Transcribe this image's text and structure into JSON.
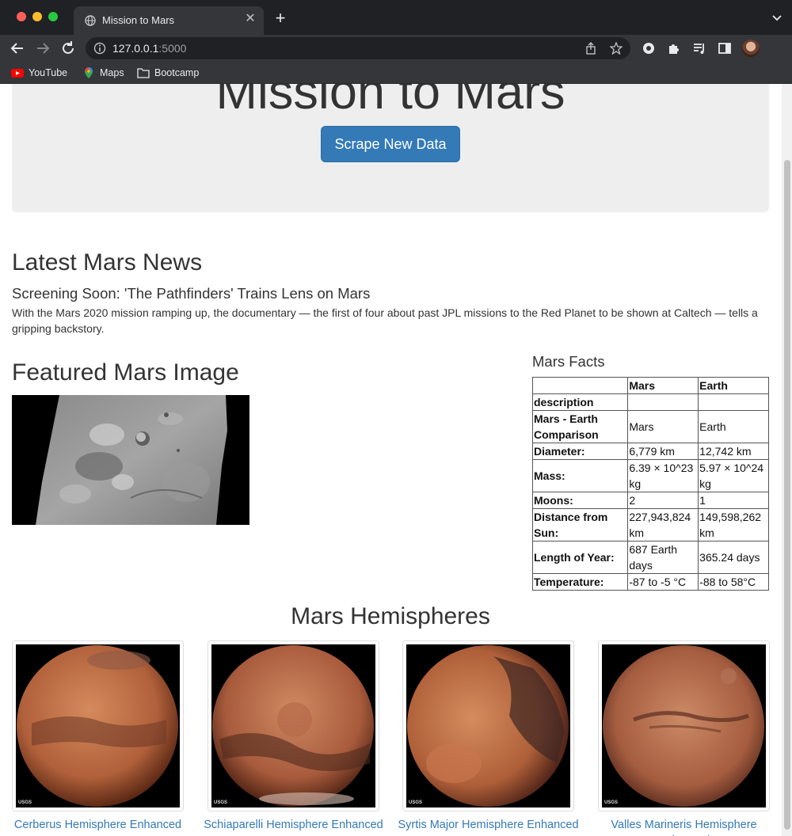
{
  "browser": {
    "tab_title": "Mission to Mars",
    "url_host": "127.0.0.1",
    "url_port": ":5000",
    "bookmarks": [
      "YouTube",
      "Maps",
      "Bootcamp"
    ]
  },
  "header": {
    "title": "Mission to Mars",
    "scrape_button": "Scrape New Data"
  },
  "news": {
    "heading": "Latest Mars News",
    "title": "Screening Soon: 'The Pathfinders' Trains Lens on Mars",
    "paragraph": "With the Mars 2020 mission ramping up, the documentary — the first of four about past JPL missions to the Red Planet to be shown at Caltech — tells a gripping backstory."
  },
  "featured": {
    "heading": "Featured Mars Image"
  },
  "facts": {
    "heading": "Mars Facts",
    "columns": [
      "",
      "Mars",
      "Earth"
    ],
    "rows": [
      [
        "description",
        "",
        ""
      ],
      [
        "Mars - Earth Comparison",
        "Mars",
        "Earth"
      ],
      [
        "Diameter:",
        "6,779 km",
        "12,742 km"
      ],
      [
        "Mass:",
        "6.39 × 10^23 kg",
        "5.97 × 10^24 kg"
      ],
      [
        "Moons:",
        "2",
        "1"
      ],
      [
        "Distance from Sun:",
        "227,943,824 km",
        "149,598,262 km"
      ],
      [
        "Length of Year:",
        "687 Earth days",
        "365.24 days"
      ],
      [
        "Temperature:",
        "-87 to -5 °C",
        "-88 to 58°C"
      ]
    ]
  },
  "hemispheres": {
    "heading": "Mars Hemispheres",
    "items": [
      {
        "title": "Cerberus Hemisphere Enhanced",
        "logo": "USGS"
      },
      {
        "title": "Schiaparelli Hemisphere Enhanced",
        "logo": "USGS"
      },
      {
        "title": "Syrtis Major Hemisphere Enhanced",
        "logo": "USGS"
      },
      {
        "title": "Valles Marineris Hemisphere Enhanced",
        "logo": "USGS"
      }
    ]
  },
  "colors": {
    "link": "#337ab7",
    "button": "#337ab7",
    "jumbotron": "#eeeeee",
    "browser_frame": "#35363a"
  }
}
